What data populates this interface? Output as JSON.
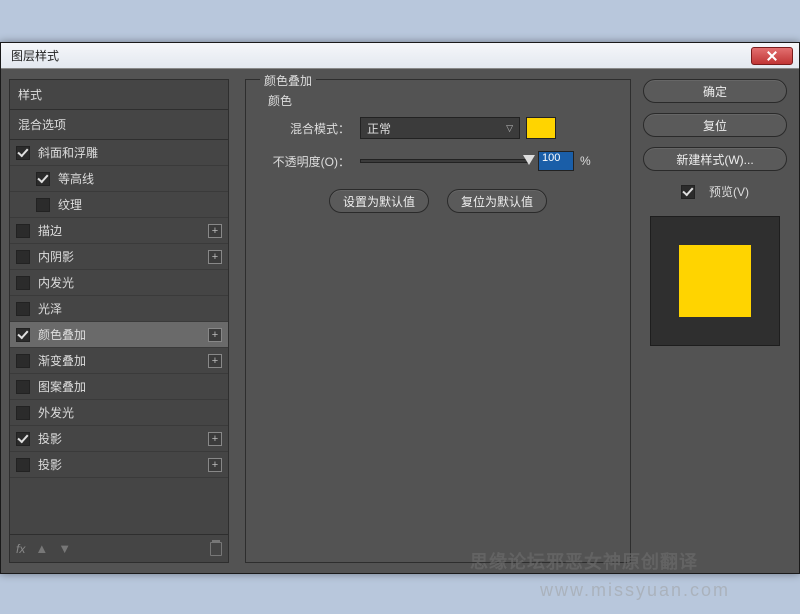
{
  "window": {
    "title": "图层样式"
  },
  "sidebar": {
    "header": "样式",
    "blend_options": "混合选项",
    "items": [
      {
        "label": "斜面和浮雕",
        "checked": true,
        "indent": false,
        "plus": false
      },
      {
        "label": "等高线",
        "checked": true,
        "indent": true,
        "plus": false
      },
      {
        "label": "纹理",
        "checked": false,
        "indent": true,
        "plus": false
      },
      {
        "label": "描边",
        "checked": false,
        "indent": false,
        "plus": true
      },
      {
        "label": "内阴影",
        "checked": false,
        "indent": false,
        "plus": true
      },
      {
        "label": "内发光",
        "checked": false,
        "indent": false,
        "plus": false
      },
      {
        "label": "光泽",
        "checked": false,
        "indent": false,
        "plus": false
      },
      {
        "label": "颜色叠加",
        "checked": true,
        "indent": false,
        "plus": true,
        "selected": true
      },
      {
        "label": "渐变叠加",
        "checked": false,
        "indent": false,
        "plus": true
      },
      {
        "label": "图案叠加",
        "checked": false,
        "indent": false,
        "plus": false
      },
      {
        "label": "外发光",
        "checked": false,
        "indent": false,
        "plus": false
      },
      {
        "label": "投影",
        "checked": true,
        "indent": false,
        "plus": true
      },
      {
        "label": "投影",
        "checked": false,
        "indent": false,
        "plus": true
      }
    ],
    "fx_label": "fx"
  },
  "center": {
    "group_title": "颜色叠加",
    "color_label": "颜色",
    "blend_mode_label": "混合模式：",
    "blend_mode_value": "正常",
    "color_swatch": "#ffd400",
    "opacity_label": "不透明度(O)：",
    "opacity_value": "100",
    "opacity_unit": "%",
    "default_btn": "设置为默认值",
    "reset_btn": "复位为默认值"
  },
  "right": {
    "ok": "确定",
    "cancel": "复位",
    "new_style": "新建样式(W)...",
    "preview": "预览(V)",
    "preview_checked": true,
    "preview_color": "#ffd400"
  },
  "watermark1": "思缘论坛邪恶女神原创翻译",
  "watermark2": "www.missyuan.com"
}
